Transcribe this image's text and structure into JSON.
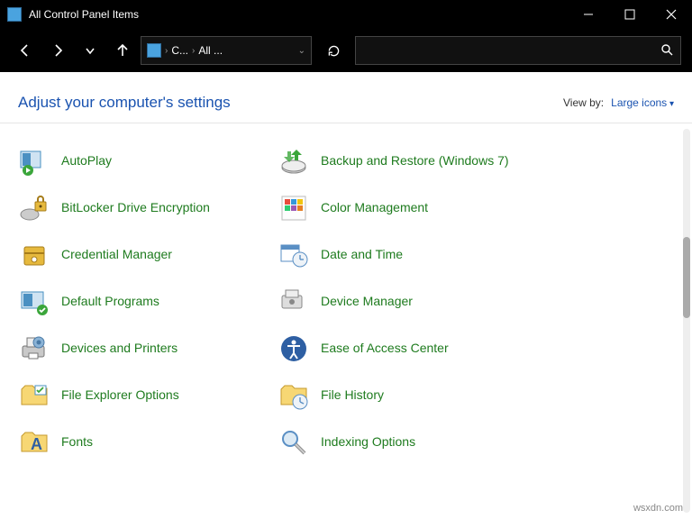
{
  "window": {
    "title": "All Control Panel Items"
  },
  "breadcrumb": {
    "c": "C...",
    "all": "All ..."
  },
  "header": {
    "title": "Adjust your computer's settings",
    "viewby_label": "View by:",
    "viewby_value": "Large icons"
  },
  "items": {
    "autoplay": "AutoPlay",
    "backup": "Backup and Restore (Windows 7)",
    "bitlocker": "BitLocker Drive Encryption",
    "color": "Color Management",
    "credential": "Credential Manager",
    "datetime": "Date and Time",
    "defaultprog": "Default Programs",
    "devicemgr": "Device Manager",
    "devprint": "Devices and Printers",
    "ease": "Ease of Access Center",
    "fileexp": "File Explorer Options",
    "filehistory": "File History",
    "fonts": "Fonts",
    "indexing": "Indexing Options"
  },
  "watermark": "wsxdn.com"
}
